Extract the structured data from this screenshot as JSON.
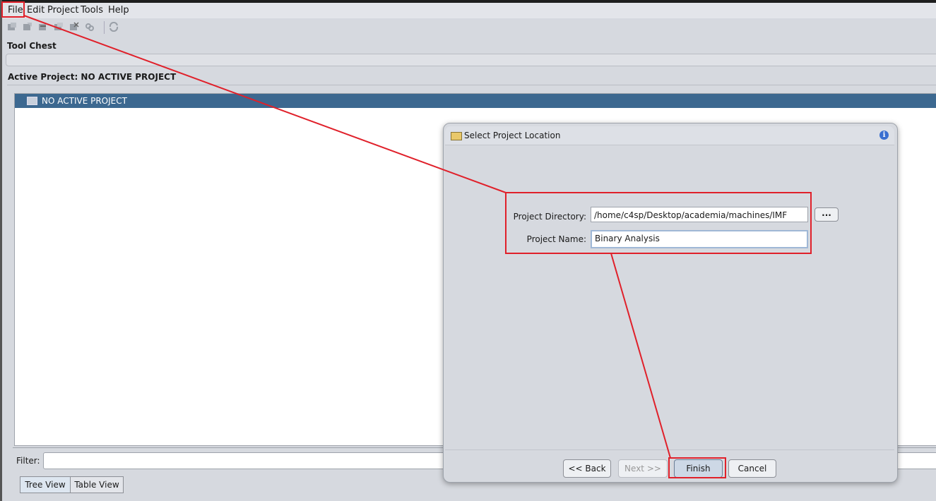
{
  "menubar": {
    "items": [
      "File",
      "Edit",
      "Project",
      "Tools",
      "Help"
    ]
  },
  "toolbar": {
    "icons": [
      "new-project-icon",
      "open-project-icon",
      "close-project-icon",
      "save-project-icon",
      "delete-project-icon",
      "link-icon",
      "refresh-icon"
    ]
  },
  "tool_chest": {
    "label": "Tool Chest"
  },
  "active_project": {
    "label": "Active Project: NO ACTIVE PROJECT",
    "tree_root": "NO ACTIVE PROJECT"
  },
  "filter": {
    "label": "Filter:",
    "value": ""
  },
  "view_tabs": [
    "Tree View",
    "Table View"
  ],
  "dialog": {
    "title": "Select Project Location",
    "project_directory_label": "Project Directory:",
    "project_directory_value": "/home/c4sp/Desktop/academia/machines/IMF",
    "browse_label": "...",
    "project_name_label": "Project Name:",
    "project_name_value": "Binary Analysis",
    "buttons": {
      "back": "<< Back",
      "next": "Next >>",
      "finish": "Finish",
      "cancel": "Cancel"
    }
  },
  "colors": {
    "annotation": "#e0202a",
    "tree_header": "#3c6890"
  }
}
